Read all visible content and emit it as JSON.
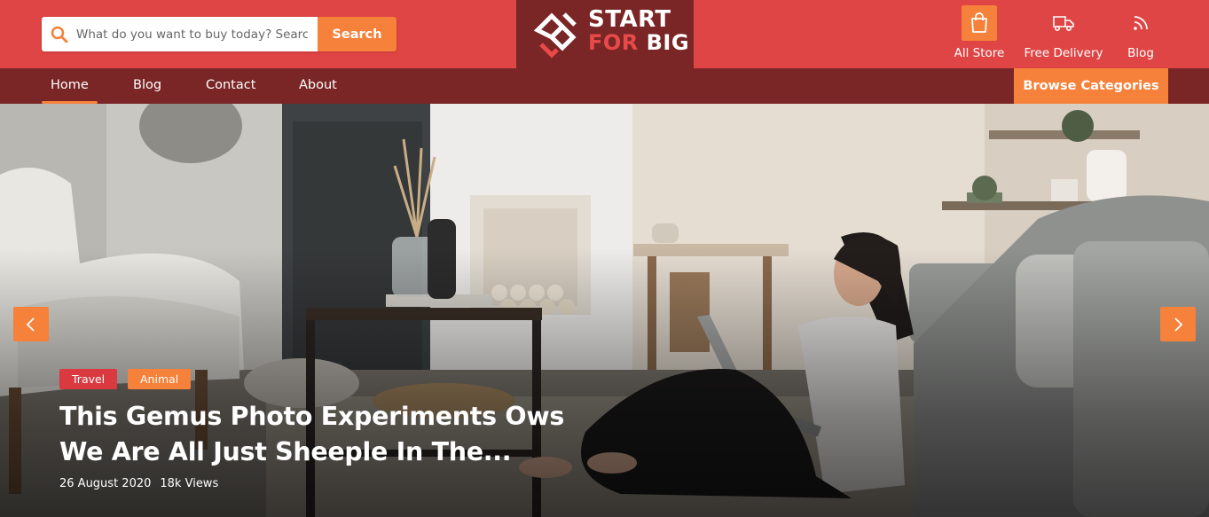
{
  "search": {
    "placeholder": "What do you want to buy today? Search",
    "button_label": "Search"
  },
  "logo": {
    "line1": "START",
    "line2_a": "FOR",
    "line2_b": "BIG"
  },
  "utility_links": [
    {
      "label": "All Store",
      "icon": "shopping-bag-icon"
    },
    {
      "label": "Free Delivery",
      "icon": "truck-icon"
    },
    {
      "label": "Blog",
      "icon": "rss-icon"
    }
  ],
  "nav": {
    "items": [
      {
        "label": "Home",
        "active": true
      },
      {
        "label": "Blog",
        "active": false
      },
      {
        "label": "Contact",
        "active": false
      },
      {
        "label": "About",
        "active": false
      }
    ],
    "browse_label": "Browse Categories"
  },
  "hero": {
    "tags": [
      {
        "label": "Travel",
        "color": "#d9393f"
      },
      {
        "label": "Animal",
        "color": "#f5813a"
      }
    ],
    "title": "This Gemus Photo Experiments Ows We Are All Just Sheeple In The...",
    "date": "26 August 2020",
    "views": "18k Views"
  },
  "colors": {
    "header_red": "#e04545",
    "dark_red": "#7a2526",
    "accent_orange": "#f5813a"
  }
}
